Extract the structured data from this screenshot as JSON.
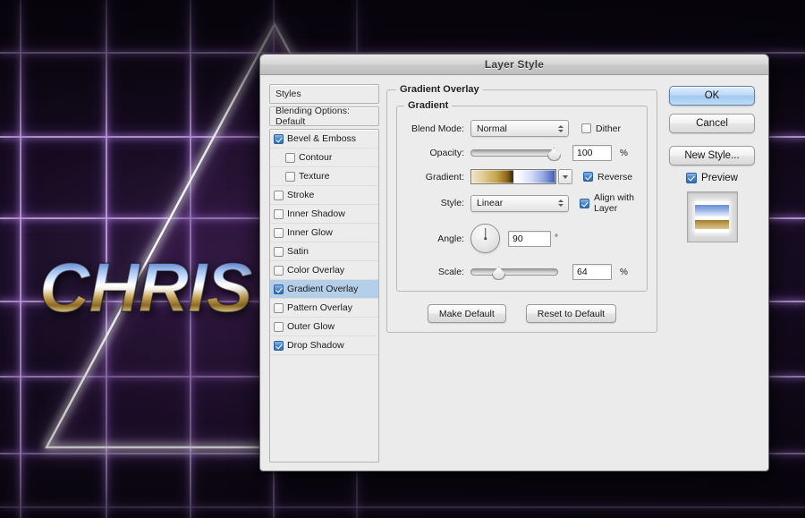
{
  "artwork": {
    "headline": "CHRIS",
    "grid_color": "#c9a8e8",
    "triangle_color": "#ffffff",
    "background_color": "#0a0610"
  },
  "dialog": {
    "title": "Layer Style",
    "styles_panel": {
      "header": "Styles",
      "blending_options": "Blending Options: Default",
      "effects": [
        {
          "label": "Bevel & Emboss",
          "checked": true,
          "indent": false,
          "selected": false
        },
        {
          "label": "Contour",
          "checked": false,
          "indent": true,
          "selected": false
        },
        {
          "label": "Texture",
          "checked": false,
          "indent": true,
          "selected": false
        },
        {
          "label": "Stroke",
          "checked": false,
          "indent": false,
          "selected": false
        },
        {
          "label": "Inner Shadow",
          "checked": false,
          "indent": false,
          "selected": false
        },
        {
          "label": "Inner Glow",
          "checked": false,
          "indent": false,
          "selected": false
        },
        {
          "label": "Satin",
          "checked": false,
          "indent": false,
          "selected": false
        },
        {
          "label": "Color Overlay",
          "checked": false,
          "indent": false,
          "selected": false
        },
        {
          "label": "Gradient Overlay",
          "checked": true,
          "indent": false,
          "selected": true
        },
        {
          "label": "Pattern Overlay",
          "checked": false,
          "indent": false,
          "selected": false
        },
        {
          "label": "Outer Glow",
          "checked": false,
          "indent": false,
          "selected": false
        },
        {
          "label": "Drop Shadow",
          "checked": true,
          "indent": false,
          "selected": false
        }
      ],
      "selection_color": "#b6cfe9"
    },
    "options_panel": {
      "group_title": "Gradient Overlay",
      "subgroup_title": "Gradient",
      "blend_mode": {
        "label": "Blend Mode:",
        "value": "Normal"
      },
      "dither": {
        "label": "Dither",
        "checked": false
      },
      "opacity": {
        "label": "Opacity:",
        "value": "100",
        "unit": "%",
        "slider_percent": 100
      },
      "gradient": {
        "label": "Gradient:",
        "stops": "cream-gold-brown-white-blue",
        "colors": [
          "#f0e6c8",
          "#c8a94f",
          "#6e5112",
          "#3a2a06",
          "#ffffff",
          "#e8eeff",
          "#93a8e0",
          "#4d62b8"
        ]
      },
      "reverse": {
        "label": "Reverse",
        "checked": true
      },
      "style": {
        "label": "Style:",
        "value": "Linear"
      },
      "align_with_layer": {
        "label": "Align with Layer",
        "checked": true
      },
      "angle": {
        "label": "Angle:",
        "value": "90",
        "unit": "°",
        "degrees": 90
      },
      "scale": {
        "label": "Scale:",
        "value": "64",
        "unit": "%",
        "slider_percent": 25
      },
      "make_default": "Make Default",
      "reset_to_default": "Reset to Default"
    },
    "actions": {
      "ok": "OK",
      "cancel": "Cancel",
      "new_style": "New Style...",
      "preview": {
        "label": "Preview",
        "checked": true
      },
      "accent_color": "#a3c9f0"
    }
  }
}
